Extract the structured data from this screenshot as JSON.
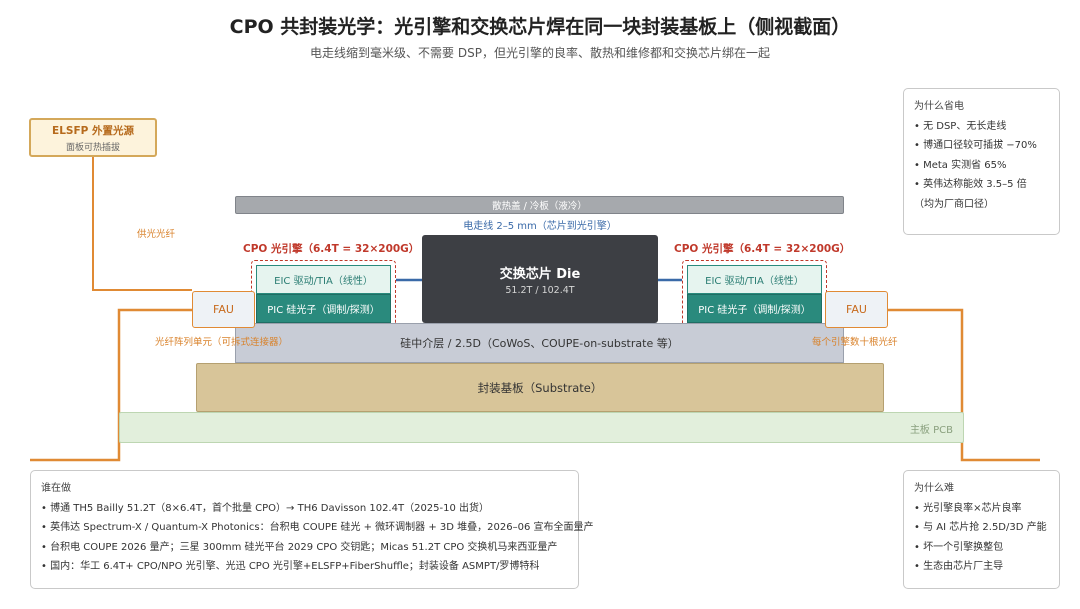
{
  "title": "CPO 共封装光学：光引擎和交换芯片焊在同一块封装基板上（侧视截面）",
  "subtitle": "电走线缩到毫米级、不需要 DSP，但光引擎的良率、散热和维修都和交换芯片绑在一起",
  "elsfp": {
    "title": "ELSFP 外置光源",
    "subtitle": "面板可热插拔"
  },
  "lid_label": "散热盖 / 冷板（液冷）",
  "wire_label": "电走线 2–5 mm（芯片到光引擎）",
  "die": {
    "title": "交换芯片 Die",
    "subtitle": "51.2T / 102.4T"
  },
  "cpo_left": {
    "label": "CPO 光引擎（6.4T = 32×200G）",
    "eic": "EIC 驱动/TIA（线性）",
    "pic": "PIC 硅光子（调制/探测）"
  },
  "cpo_right": {
    "label": "CPO 光引擎（6.4T = 32×200G）",
    "eic": "EIC 驱动/TIA（线性）",
    "pic": "PIC 硅光子（调制/探测）"
  },
  "fau_left": "FAU",
  "fau_right": "FAU",
  "interposer_label": "硅中介层 / 2.5D（CoWoS、COUPE-on-substrate 等）",
  "substrate_label": "封装基板（Substrate）",
  "pcb_label": "主板 PCB",
  "notes": {
    "feed_fiber": "供光光纤",
    "fiber_array": "光纤阵列单元（可拆式连接器）",
    "per_engine": "每个引擎数十根光纤"
  },
  "why_save": {
    "heading": "为什么省电",
    "items": [
      "无 DSP、无长走线",
      "博通口径较可插拔 −70%",
      "Meta 实测省 65%",
      "英伟达称能效 3.5–5 倍"
    ],
    "footnote": "（均为厂商口径）"
  },
  "why_hard": {
    "heading": "为什么难",
    "items": [
      "光引擎良率×芯片良率",
      "与 AI 芯片抢 2.5D/3D 产能",
      "坏一个引擎换整包",
      "生态由芯片厂主导"
    ]
  },
  "who": {
    "heading": "谁在做",
    "items": [
      "博通 TH5 Bailly 51.2T（8×6.4T，首个批量 CPO）→ TH6 Davisson 102.4T（2025-10 出货）",
      "英伟达 Spectrum-X / Quantum-X Photonics：台积电 COUPE 硅光 + 微环调制器 + 3D 堆叠，2026–06 宣布全面量产",
      "台积电 COUPE 2026 量产；三星 300mm 硅光平台 2029 CPO 交钥匙；Micas 51.2T CPO 交换机马来西亚量产",
      "国内：华工 6.4T+ CPO/NPO 光引擎、光迅 CPO 光引擎+ELSFP+FiberShuffle；封装设备 ASMPT/罗博特科"
    ]
  },
  "colors": {
    "fiber": "#e08a34",
    "cpo_red": "#c0392b",
    "pic_teal": "#2a8a7d",
    "die": "#3d3f44",
    "substrate": "#d8c599",
    "interposer": "#c8ccd6",
    "pcb": "#e2efdc",
    "wire_blue": "#3a6aa8"
  }
}
